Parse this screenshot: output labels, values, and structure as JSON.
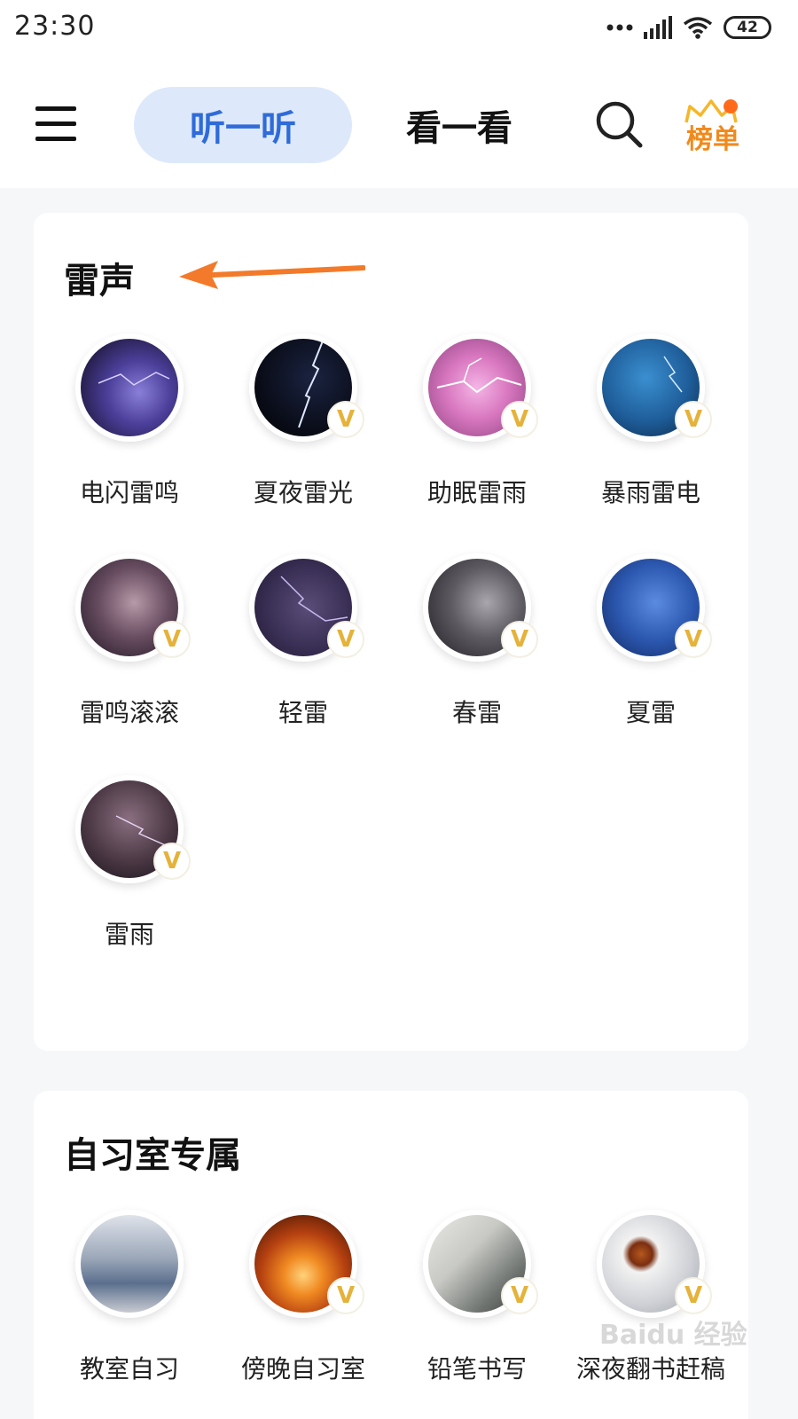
{
  "status_bar": {
    "time": "23:30",
    "battery": "42"
  },
  "nav": {
    "tabs": [
      {
        "label": "听一听",
        "active": true
      },
      {
        "label": "看一看",
        "active": false
      }
    ],
    "rank_label": "榜单",
    "accent_color": "#2f6bd9",
    "rank_color": "#f08a1c"
  },
  "sections": [
    {
      "title": "雷声",
      "items": [
        {
          "label": "电闪雷鸣",
          "vip": false,
          "icon": "lightning-thumbnail"
        },
        {
          "label": "夏夜雷光",
          "vip": true,
          "icon": "lightning-thumbnail"
        },
        {
          "label": "助眠雷雨",
          "vip": true,
          "icon": "lightning-thumbnail"
        },
        {
          "label": "暴雨雷电",
          "vip": true,
          "icon": "lightning-thumbnail"
        },
        {
          "label": "雷鸣滚滚",
          "vip": true,
          "icon": "storm-cloud-thumbnail"
        },
        {
          "label": "轻雷",
          "vip": true,
          "icon": "storm-cloud-thumbnail"
        },
        {
          "label": "春雷",
          "vip": true,
          "icon": "storm-cloud-thumbnail"
        },
        {
          "label": "夏雷",
          "vip": true,
          "icon": "storm-cloud-thumbnail"
        },
        {
          "label": "雷雨",
          "vip": true,
          "icon": "storm-cloud-thumbnail"
        }
      ]
    },
    {
      "title": "自习室专属",
      "items": [
        {
          "label": "教室自习",
          "vip": false,
          "icon": "classroom-thumbnail"
        },
        {
          "label": "傍晚自习室",
          "vip": true,
          "icon": "sunset-thumbnail"
        },
        {
          "label": "铅笔书写",
          "vip": true,
          "icon": "notebook-thumbnail"
        },
        {
          "label": "深夜翻书赶稿",
          "vip": true,
          "icon": "desk-coffee-thumbnail"
        }
      ]
    }
  ],
  "vip_mark": "V",
  "watermark": "Baidu 经验"
}
